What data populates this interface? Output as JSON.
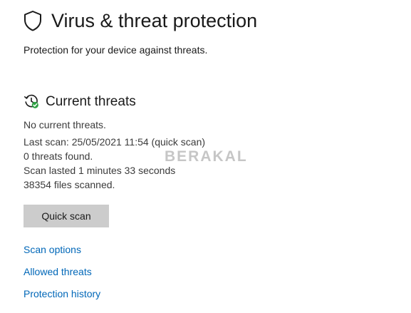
{
  "header": {
    "icon": "shield-icon",
    "title": "Virus & threat protection",
    "subtitle": "Protection for your device against threats."
  },
  "current_threats": {
    "icon": "refresh-clock-check-icon",
    "icon_badge_color": "#2ea043",
    "title": "Current threats",
    "lines": [
      "No current threats.",
      "Last scan: 25/05/2021 11:54 (quick scan)",
      "0 threats found.",
      "Scan lasted 1 minutes 33 seconds",
      "38354 files scanned."
    ],
    "quick_scan_label": "Quick scan"
  },
  "watermark": "BERAKAL",
  "links": {
    "scan_options": "Scan options",
    "allowed_threats": "Allowed threats",
    "protection_history": "Protection history"
  },
  "colors": {
    "link": "#0067b8",
    "button_bg": "#cccccc",
    "text": "#1a1a1a"
  }
}
